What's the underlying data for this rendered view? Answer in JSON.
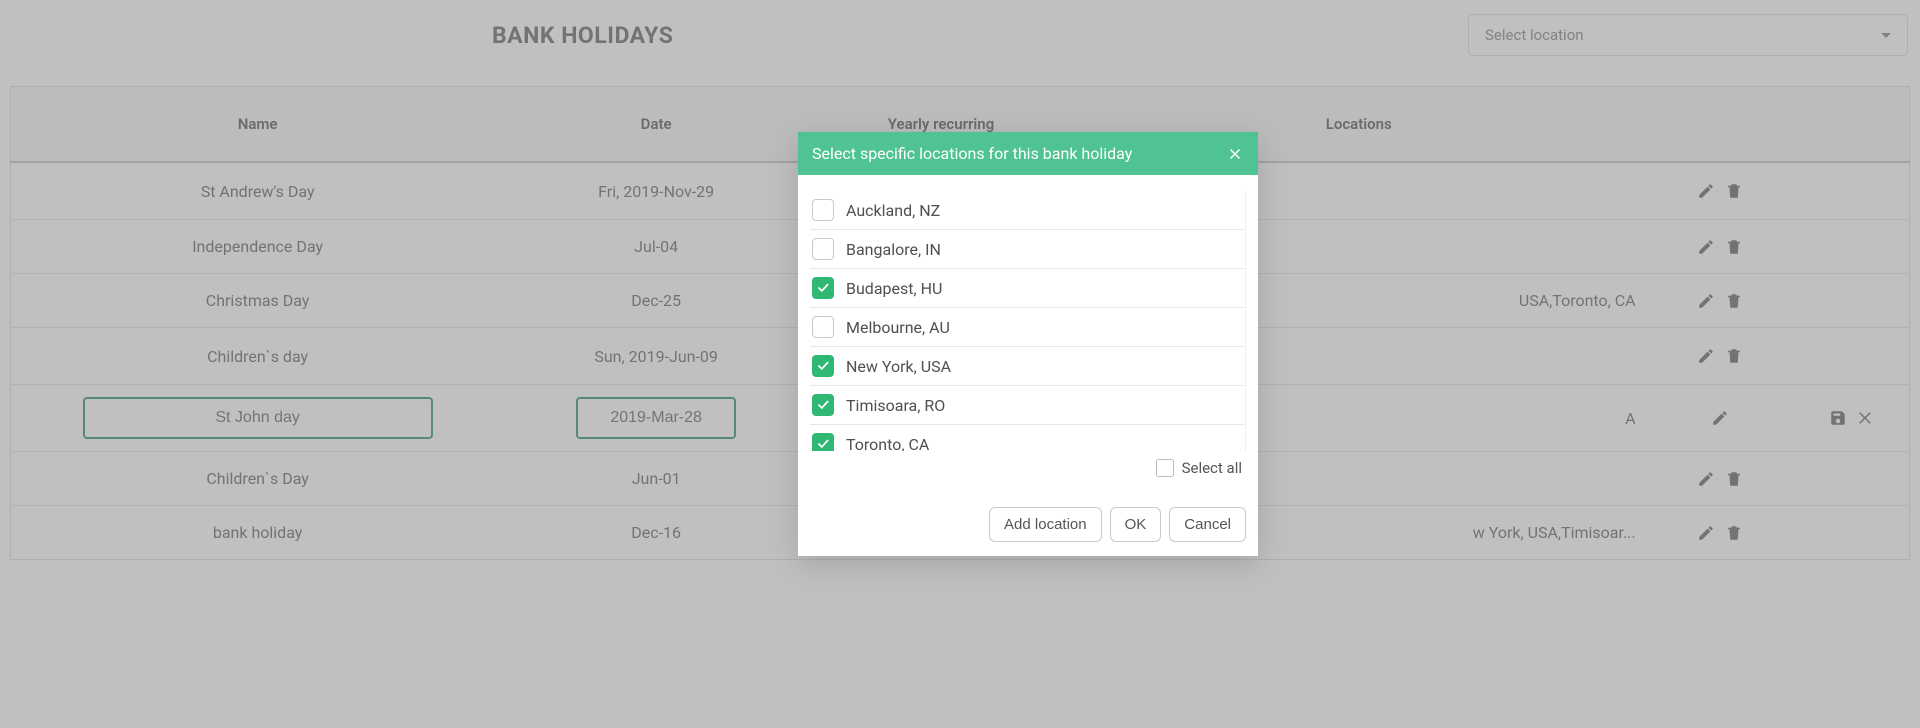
{
  "page": {
    "title": "BANK HOLIDAYS"
  },
  "location_dropdown": {
    "placeholder": "Select location"
  },
  "columns": {
    "name": "Name",
    "date": "Date",
    "recurring": "Yearly recurring",
    "locations": "Locations"
  },
  "rows": [
    {
      "name": "St Andrew's Day",
      "date": "Fri, 2019-Nov-29",
      "recurring": false,
      "recurring_checked_green": false,
      "locations": "",
      "editing": false
    },
    {
      "name": "Independence Day",
      "date": "Jul-04",
      "recurring": true,
      "recurring_checked_green": false,
      "locations": "",
      "editing": false
    },
    {
      "name": "Christmas Day",
      "date": "Dec-25",
      "recurring": true,
      "recurring_checked_green": false,
      "locations": "USA,Toronto, CA",
      "editing": false
    },
    {
      "name": "Children`s day",
      "date": "Sun, 2019-Jun-09",
      "recurring": false,
      "recurring_checked_green": false,
      "locations": "",
      "editing": false
    },
    {
      "name": "St John day",
      "date": "2019-Mar-28",
      "recurring": true,
      "recurring_checked_green": true,
      "locations": "A",
      "editing": true
    },
    {
      "name": "Children`s Day",
      "date": "Jun-01",
      "recurring": true,
      "recurring_checked_green": false,
      "locations": "",
      "editing": false
    },
    {
      "name": "bank holiday",
      "date": "Dec-16",
      "recurring": true,
      "recurring_checked_green": false,
      "locations": "w York, USA,Timisoar...",
      "editing": false
    }
  ],
  "modal": {
    "title": "Select specific locations for this bank holiday",
    "select_all": "Select all",
    "options": [
      {
        "label": "Auckland, NZ",
        "checked": false
      },
      {
        "label": "Bangalore, IN",
        "checked": false
      },
      {
        "label": "Budapest, HU",
        "checked": true
      },
      {
        "label": "Melbourne, AU",
        "checked": false
      },
      {
        "label": "New York, USA",
        "checked": true
      },
      {
        "label": "Timisoara, RO",
        "checked": true
      },
      {
        "label": "Toronto, CA",
        "checked": true
      }
    ],
    "footer": {
      "add": "Add location",
      "ok": "OK",
      "cancel": "Cancel"
    }
  }
}
